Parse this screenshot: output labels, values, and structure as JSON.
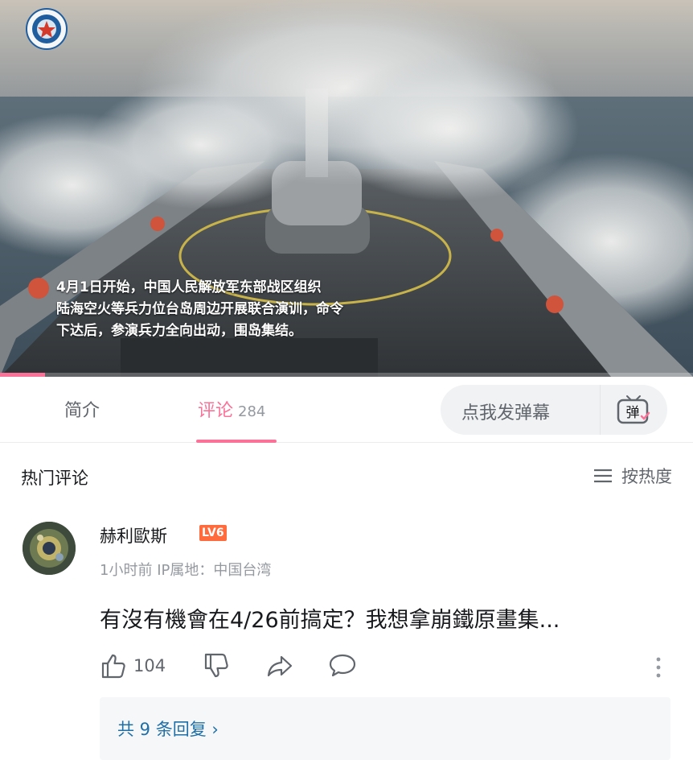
{
  "video": {
    "caption_lines": [
      "4月1日开始，中国人民解放军东部战区组织",
      "陆海空火等兵力位台岛周边开展联合演训，命令",
      "下达后，参演兵力全向出动，围岛集结。"
    ],
    "logo_icon": "military-emblem-icon",
    "progress": 0.065
  },
  "tabs": [
    {
      "label": "简介"
    },
    {
      "label": "评论",
      "count": "284"
    }
  ],
  "danmaku": {
    "placeholder": "点我发弹幕",
    "toggle_label": "弹"
  },
  "hot_comments": {
    "title": "热门评论",
    "sort_label": "按热度"
  },
  "comment": {
    "username": "赫利歐斯",
    "level": "LV6",
    "time": "1小时前",
    "ip_location": "IP属地：中国台湾",
    "text": "有沒有機會在4/26前搞定？我想拿崩鐵原畫集...",
    "likes": "104",
    "replies_label": "共 9 条回复",
    "replies_chevron": "›"
  },
  "colors": {
    "accent": "#fb7299",
    "level_badge": "#ff6b3d",
    "link": "#1f6fa8",
    "text_primary": "#18191c",
    "text_secondary": "#61666d",
    "text_muted": "#9499a0"
  }
}
